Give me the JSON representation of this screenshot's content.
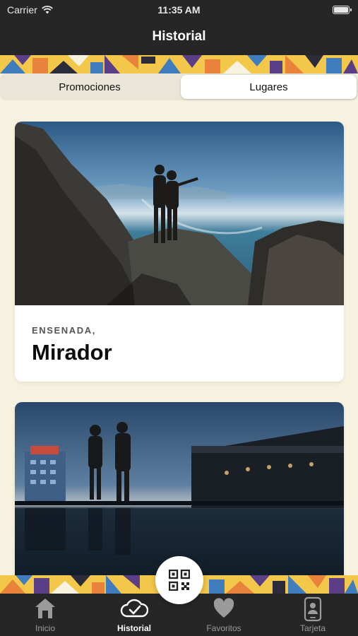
{
  "status": {
    "carrier": "Carrier",
    "time": "11:35 AM",
    "icons": [
      "wifi-icon",
      "battery-icon"
    ]
  },
  "navbar": {
    "title": "Historial"
  },
  "segments": {
    "promociones": "Promociones",
    "lugares": "Lugares",
    "selected": "Lugares"
  },
  "cards": [
    {
      "location": "ENSENADA,",
      "name": "Mirador",
      "image": "couple-on-coastal-cliff-photo"
    },
    {
      "location": "",
      "name": "",
      "image": "couple-on-rooftop-pool-photo"
    }
  ],
  "fab": {
    "icon": "qr-code-icon"
  },
  "tabs": [
    {
      "label": "Inicio",
      "icon": "home-icon"
    },
    {
      "label": "Historial",
      "icon": "cloud-check-icon",
      "active": true
    },
    {
      "label": "Favoritos",
      "icon": "heart-icon"
    },
    {
      "label": "Tarjeta",
      "icon": "phone-card-icon"
    }
  ],
  "colors": {
    "bar": "#262626",
    "background": "#f6f2df",
    "pattern_yellow": "#f3c74a",
    "pattern_blue": "#3f7dbf",
    "pattern_purple": "#5a3f86",
    "pattern_orange": "#e9823a"
  }
}
